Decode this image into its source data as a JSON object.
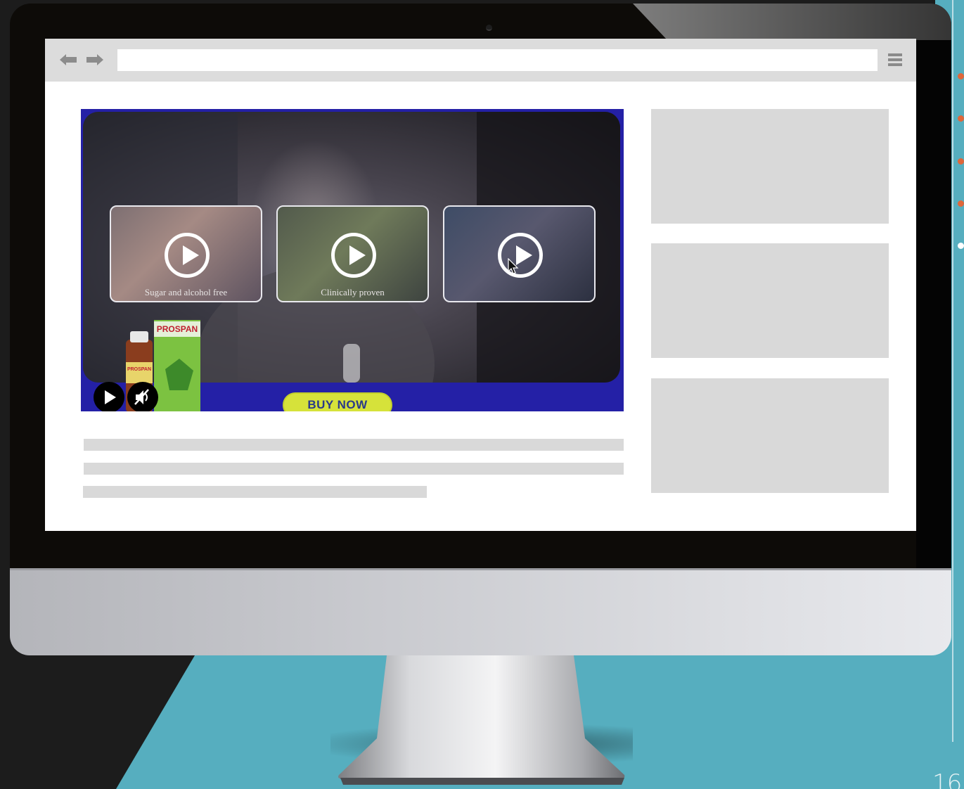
{
  "slide": {
    "page_number": "16",
    "colors": {
      "teal": "#56aebf",
      "dark": "#1c1c1c",
      "accent_dots": "#e0673a"
    }
  },
  "browser": {
    "nav": {
      "back_icon": "arrow-left-icon",
      "forward_icon": "arrow-right-icon",
      "menu_icon": "hamburger-menu-icon"
    },
    "url_value": ""
  },
  "video_ad": {
    "thumbnails": [
      {
        "caption": "Sugar and alcohol free",
        "icon": "play-icon"
      },
      {
        "caption": "Clinically proven",
        "icon": "play-icon"
      },
      {
        "caption": "",
        "icon": "play-icon"
      }
    ],
    "product_brand": "PROSPAN",
    "cta_label": "BUY NOW",
    "controls": {
      "play_icon": "play-icon",
      "mute_icon": "mute-icon"
    },
    "colors": {
      "frame": "#2420a6",
      "cta": "#d6e23a",
      "cta_text": "#2a3a8a"
    }
  }
}
